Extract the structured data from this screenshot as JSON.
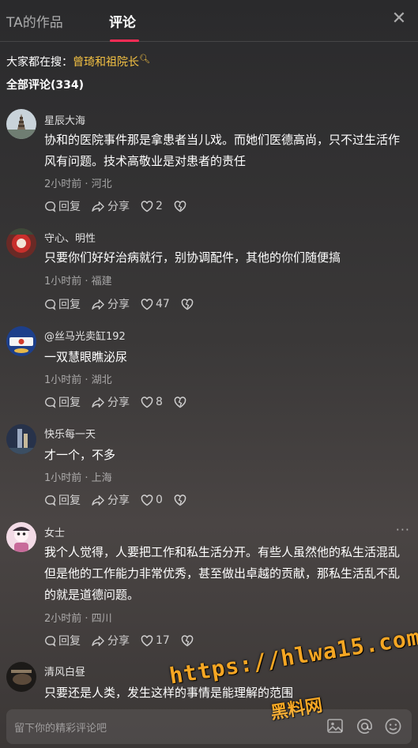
{
  "tabs": {
    "works": "TA的作品",
    "comments": "评论"
  },
  "search": {
    "prefix": "大家都在搜：",
    "query": "曾琦和祖院长"
  },
  "comment_count": "全部评论(334)",
  "actions": {
    "reply": "回复",
    "share": "分享"
  },
  "comments": [
    {
      "name": "星辰大海",
      "text": "协和的医院事件那是拿患者当儿戏。而她们医德高尚，只不过生活作风有问题。技术高敬业是对患者的责任",
      "meta": "2小时前 · 河北",
      "likes": "2"
    },
    {
      "name": "守心、明性",
      "text": "只要你们好好治病就行，别协调配件，其他的你们随便搞",
      "meta": "1小时前 · 福建",
      "likes": "47"
    },
    {
      "name": "@丝马光卖缸192",
      "text": "一双慧眼瞧泌尿",
      "meta": "1小时前 · 湖北",
      "likes": "8"
    },
    {
      "name": "快乐每一天",
      "text": "才一个，不多",
      "meta": "1小时前 · 上海",
      "likes": "0"
    },
    {
      "name": "女士",
      "text": "我个人觉得，人要把工作和私生活分开。有些人虽然他的私生活混乱但是他的工作能力非常优秀，甚至做出卓越的贡献，那私生活乱不乱的就是道德问题。",
      "meta": "2小时前 · 四川",
      "likes": "17"
    },
    {
      "name": "清风白昼",
      "text": "只要还是人类，发生这样的事情是能理解的范围",
      "meta": "",
      "likes": ""
    }
  ],
  "input": {
    "placeholder": "留下你的精彩评论吧"
  },
  "watermark": {
    "url": "https://hlwa15.com",
    "name": "黑料网"
  },
  "colors": {
    "accent": "#fe2c55",
    "search_link": "#f6c343",
    "watermark": "#f5a623"
  }
}
